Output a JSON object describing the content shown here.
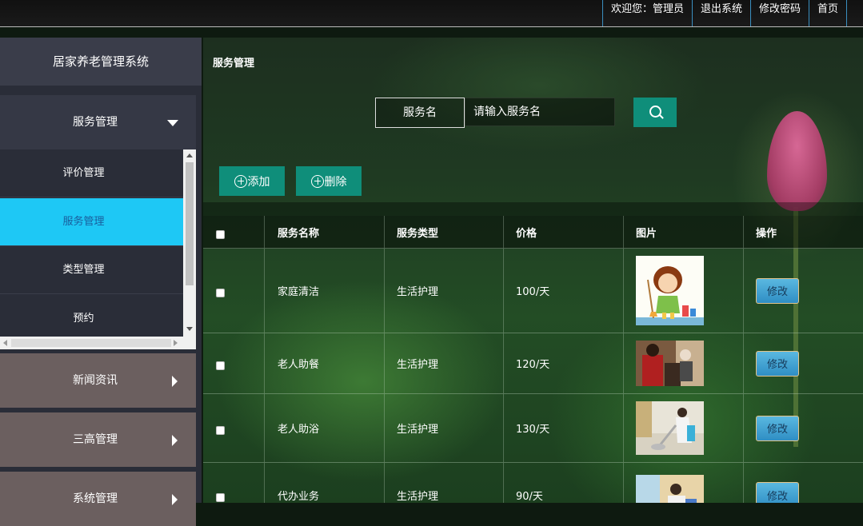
{
  "topbar": {
    "welcome": "欢迎您：管理员",
    "logout": "退出系统",
    "change_password": "修改密码",
    "home": "首页"
  },
  "sidebar": {
    "title": "居家养老管理系统",
    "menus": [
      {
        "label": "服务管理",
        "expanded": true
      },
      {
        "label": "新闻资讯",
        "expanded": false
      },
      {
        "label": "三高管理",
        "expanded": false
      },
      {
        "label": "系统管理",
        "expanded": false
      }
    ],
    "submenu": [
      "评价管理",
      "服务管理",
      "类型管理",
      "预约"
    ],
    "selected_submenu": "服务管理"
  },
  "main": {
    "page_title": "服务管理",
    "search": {
      "label": "服务名",
      "placeholder": "请输入服务名"
    },
    "add_label": "添加",
    "delete_label": "删除",
    "table": {
      "headers": [
        "服务名称",
        "服务类型",
        "价格",
        "图片",
        "操作"
      ],
      "edit_label": "修改",
      "rows": [
        {
          "name": "家庭清洁",
          "type": "生活护理",
          "price": "100/天"
        },
        {
          "name": "老人助餐",
          "type": "生活护理",
          "price": "120/天"
        },
        {
          "name": "老人助浴",
          "type": "生活护理",
          "price": "130/天"
        },
        {
          "name": "代办业务",
          "type": "生活护理",
          "price": "90/天"
        }
      ]
    }
  },
  "colors": {
    "accent_teal": "#0f8e7a",
    "selected_menu": "#1ec8f5",
    "edit_button": "#2f8ec4"
  }
}
